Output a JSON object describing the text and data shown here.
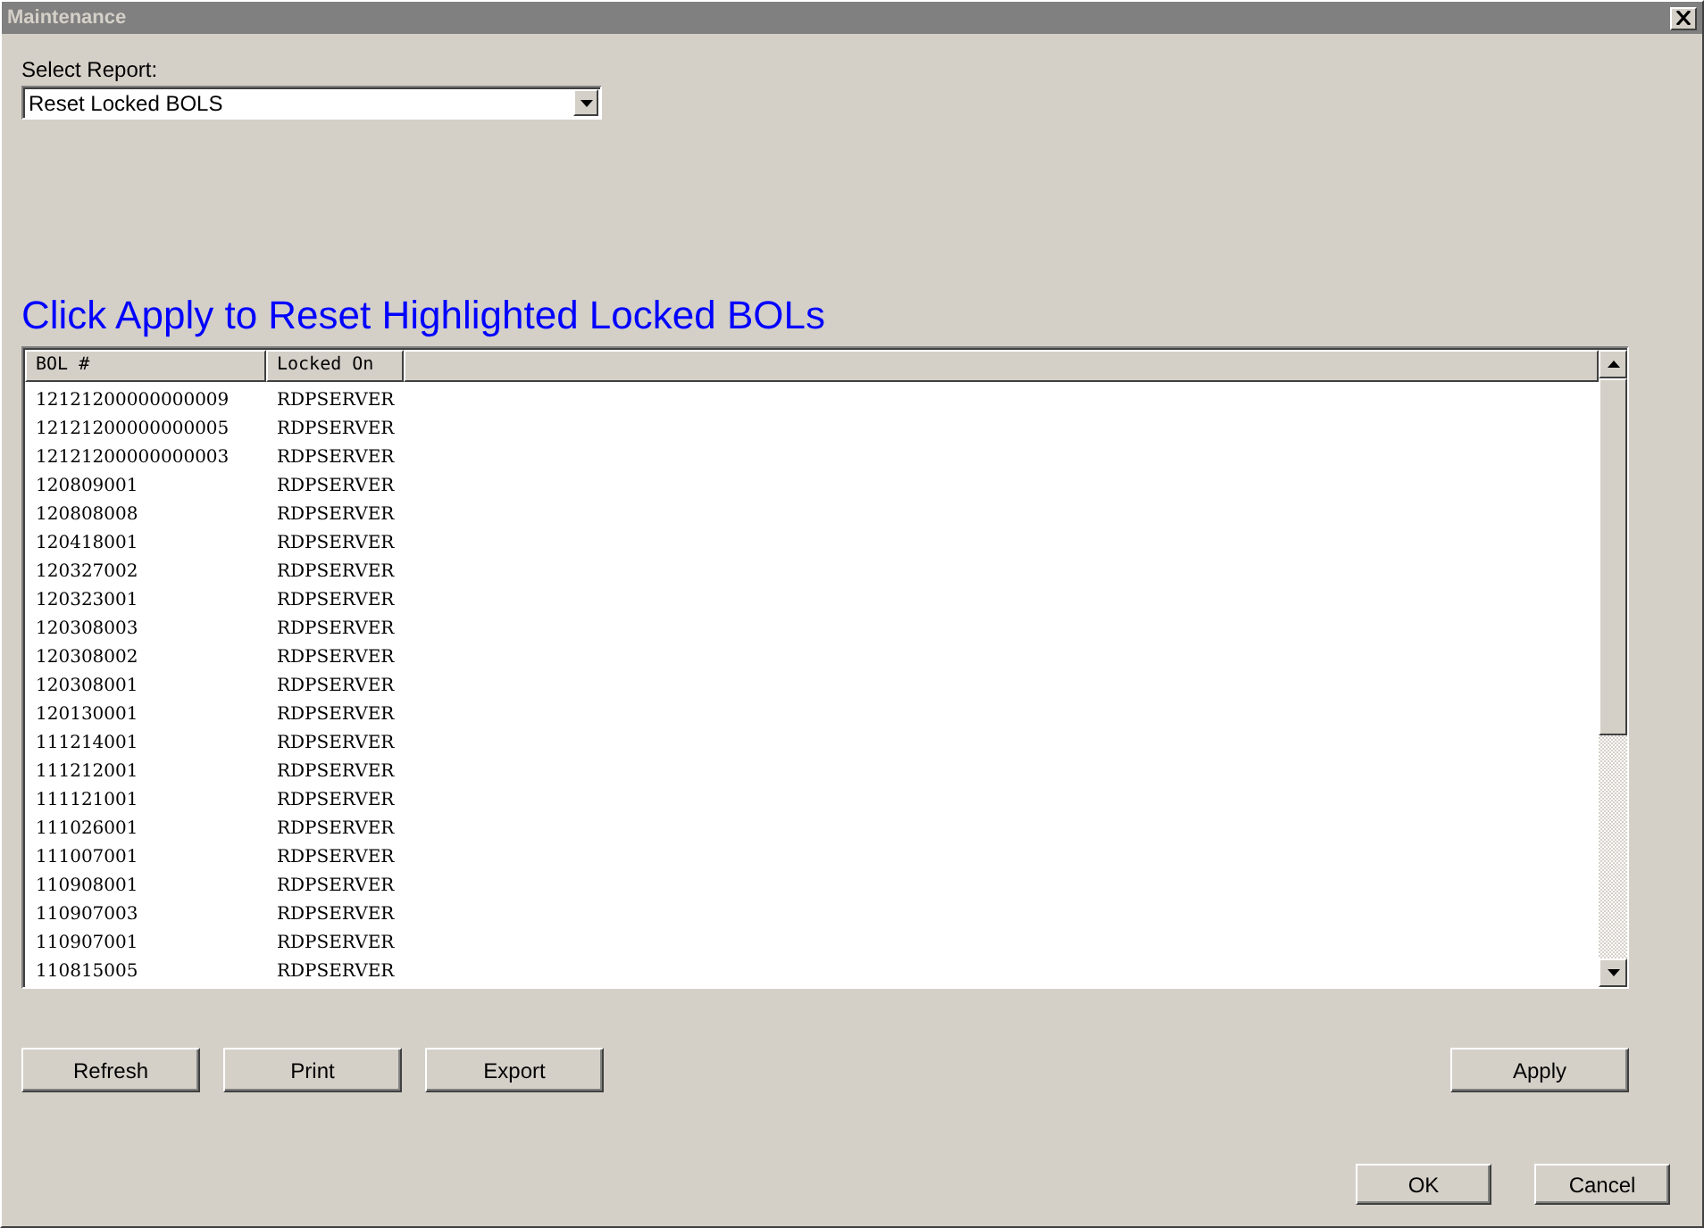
{
  "window": {
    "title": "Maintenance"
  },
  "report": {
    "label": "Select Report:",
    "value": "Reset Locked BOLS"
  },
  "heading": "Click Apply to Reset Highlighted Locked BOLs",
  "table": {
    "columns": [
      "BOL #",
      "Locked On"
    ],
    "rows": [
      [
        "12121200000000009",
        "RDPSERVER"
      ],
      [
        "12121200000000005",
        "RDPSERVER"
      ],
      [
        "12121200000000003",
        "RDPSERVER"
      ],
      [
        "120809001",
        "RDPSERVER"
      ],
      [
        "120808008",
        "RDPSERVER"
      ],
      [
        "120418001",
        "RDPSERVER"
      ],
      [
        "120327002",
        "RDPSERVER"
      ],
      [
        "120323001",
        "RDPSERVER"
      ],
      [
        "120308003",
        "RDPSERVER"
      ],
      [
        "120308002",
        "RDPSERVER"
      ],
      [
        "120308001",
        "RDPSERVER"
      ],
      [
        "120130001",
        "RDPSERVER"
      ],
      [
        "111214001",
        "RDPSERVER"
      ],
      [
        "111212001",
        "RDPSERVER"
      ],
      [
        "111121001",
        "RDPSERVER"
      ],
      [
        "111026001",
        "RDPSERVER"
      ],
      [
        "111007001",
        "RDPSERVER"
      ],
      [
        "110908001",
        "RDPSERVER"
      ],
      [
        "110907003",
        "RDPSERVER"
      ],
      [
        "110907001",
        "RDPSERVER"
      ],
      [
        "110815005",
        "RDPSERVER"
      ]
    ]
  },
  "actions": [
    "Refresh",
    "Print",
    "Export"
  ],
  "apply": "Apply",
  "dialog_buttons": [
    "OK",
    "Cancel"
  ]
}
